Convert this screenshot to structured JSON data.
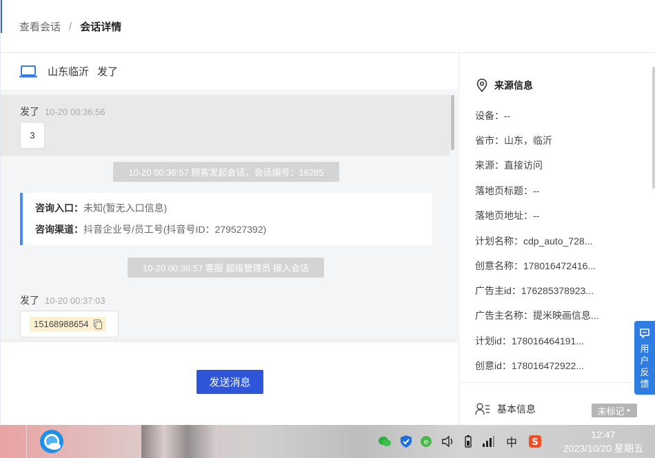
{
  "breadcrumb": {
    "prev": "查看会话",
    "separator": "/",
    "current": "会话详情"
  },
  "chat_header": {
    "location": "山东临沂",
    "name": "发了"
  },
  "messages": {
    "m1": {
      "sender": "发了",
      "time": "10-20 00:36:56",
      "content": "3"
    },
    "sys1": "10-20 00:36:57 顾客发起会话，会话编号：18285",
    "info_card": {
      "entry_label": "咨询入口：",
      "entry_value": "未知(暂无入口信息)",
      "channel_label": "咨询渠道：",
      "channel_value": "抖音企业号/员工号(抖音号ID：279527392)"
    },
    "sys2": "10-20 00:36:57 客服 超级管理员 接入会话",
    "m2": {
      "sender": "发了",
      "time": "10-20 00:37:03",
      "content": "15168988654"
    }
  },
  "send_button": "发送消息",
  "source_info": {
    "title": "来源信息",
    "rows": [
      "设备：--",
      "省市：山东，临沂",
      "来源：直接访问",
      "落地页标题：--",
      "落地页地址：--",
      "计划名称：cdp_auto_728...",
      "创意名称：178016472416...",
      "广告主id：176285378923...",
      "广告主名称：提米映画信息...",
      "计划id：178016464191...",
      "创意id：178016472922..."
    ]
  },
  "basic_info": {
    "title": "基本信息",
    "tag": "未标记"
  },
  "feedback": "用户反馈",
  "taskbar": {
    "ime": "中",
    "clock_time": "12:47",
    "clock_date": "2023/10/20 星期五"
  },
  "colors": {
    "primary": "#2f55d8",
    "accent": "#4a8ef5",
    "feedback": "#2f7de1"
  }
}
